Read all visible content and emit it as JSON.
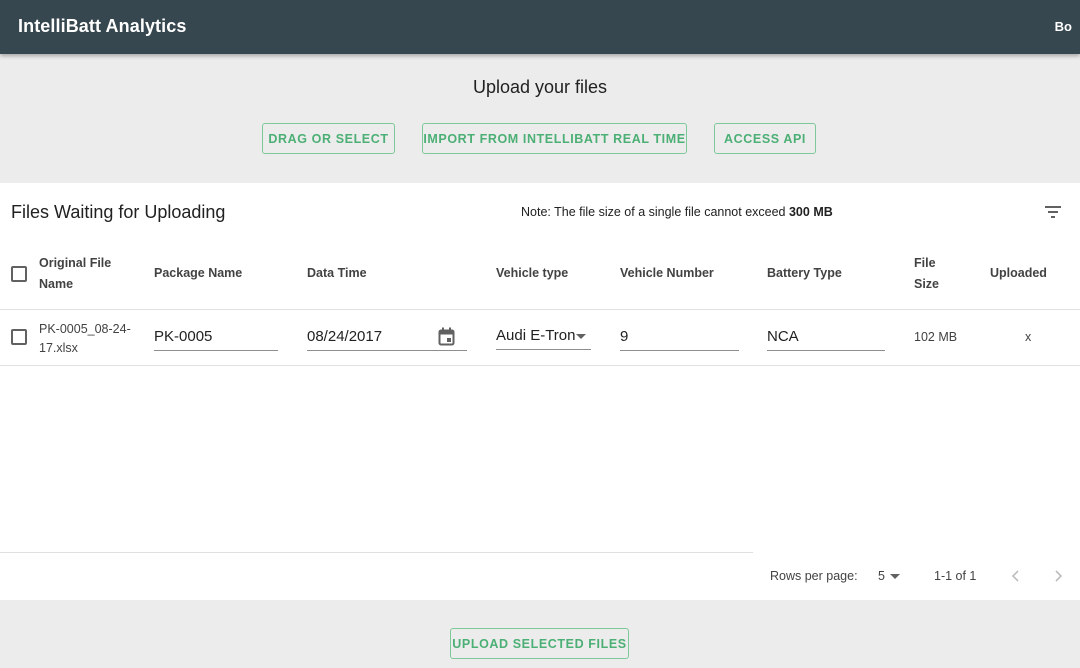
{
  "app": {
    "title": "IntelliBatt Analytics",
    "user": "Bo"
  },
  "upload": {
    "heading": "Upload your files",
    "buttons": {
      "drag": "DRAG OR SELECT",
      "import": "IMPORT FROM INTELLIBATT REAL TIME",
      "api": "ACCESS API"
    }
  },
  "table": {
    "title": "Files Waiting for Uploading",
    "note_prefix": "Note: The file size of a single file cannot exceed ",
    "note_limit": "300 MB",
    "columns": {
      "original_file_name_1": "Original File",
      "original_file_name_2": "Name",
      "package_name": "Package Name",
      "data_time": "Data Time",
      "vehicle_type": "Vehicle type",
      "vehicle_number": "Vehicle Number",
      "battery_type": "Battery Type",
      "file_size_1": "File",
      "file_size_2": "Size",
      "uploaded": "Uploaded"
    },
    "rows": [
      {
        "file_name_1": "PK-0005_08-24-",
        "file_name_2": "17.xlsx",
        "package_name": "PK-0005",
        "data_time": "08/24/2017",
        "vehicle_type": "Audi E-Tron",
        "vehicle_number": "9",
        "battery_type": "NCA",
        "file_size": "102 MB",
        "uploaded": "x"
      }
    ],
    "pagination": {
      "rows_per_page_label": "Rows per page:",
      "rows_per_page_value": "5",
      "range": "1-1 of 1"
    }
  },
  "actions": {
    "upload_selected": "UPLOAD SELECTED FILES"
  },
  "colors": {
    "appbar": "#37474f",
    "accent_green": "#4caf75",
    "background": "#ececec"
  },
  "icons": [
    "filter-list-icon",
    "calendar-icon",
    "dropdown-arrow-icon",
    "chevron-left-icon",
    "chevron-right-icon",
    "checkbox-icon"
  ]
}
